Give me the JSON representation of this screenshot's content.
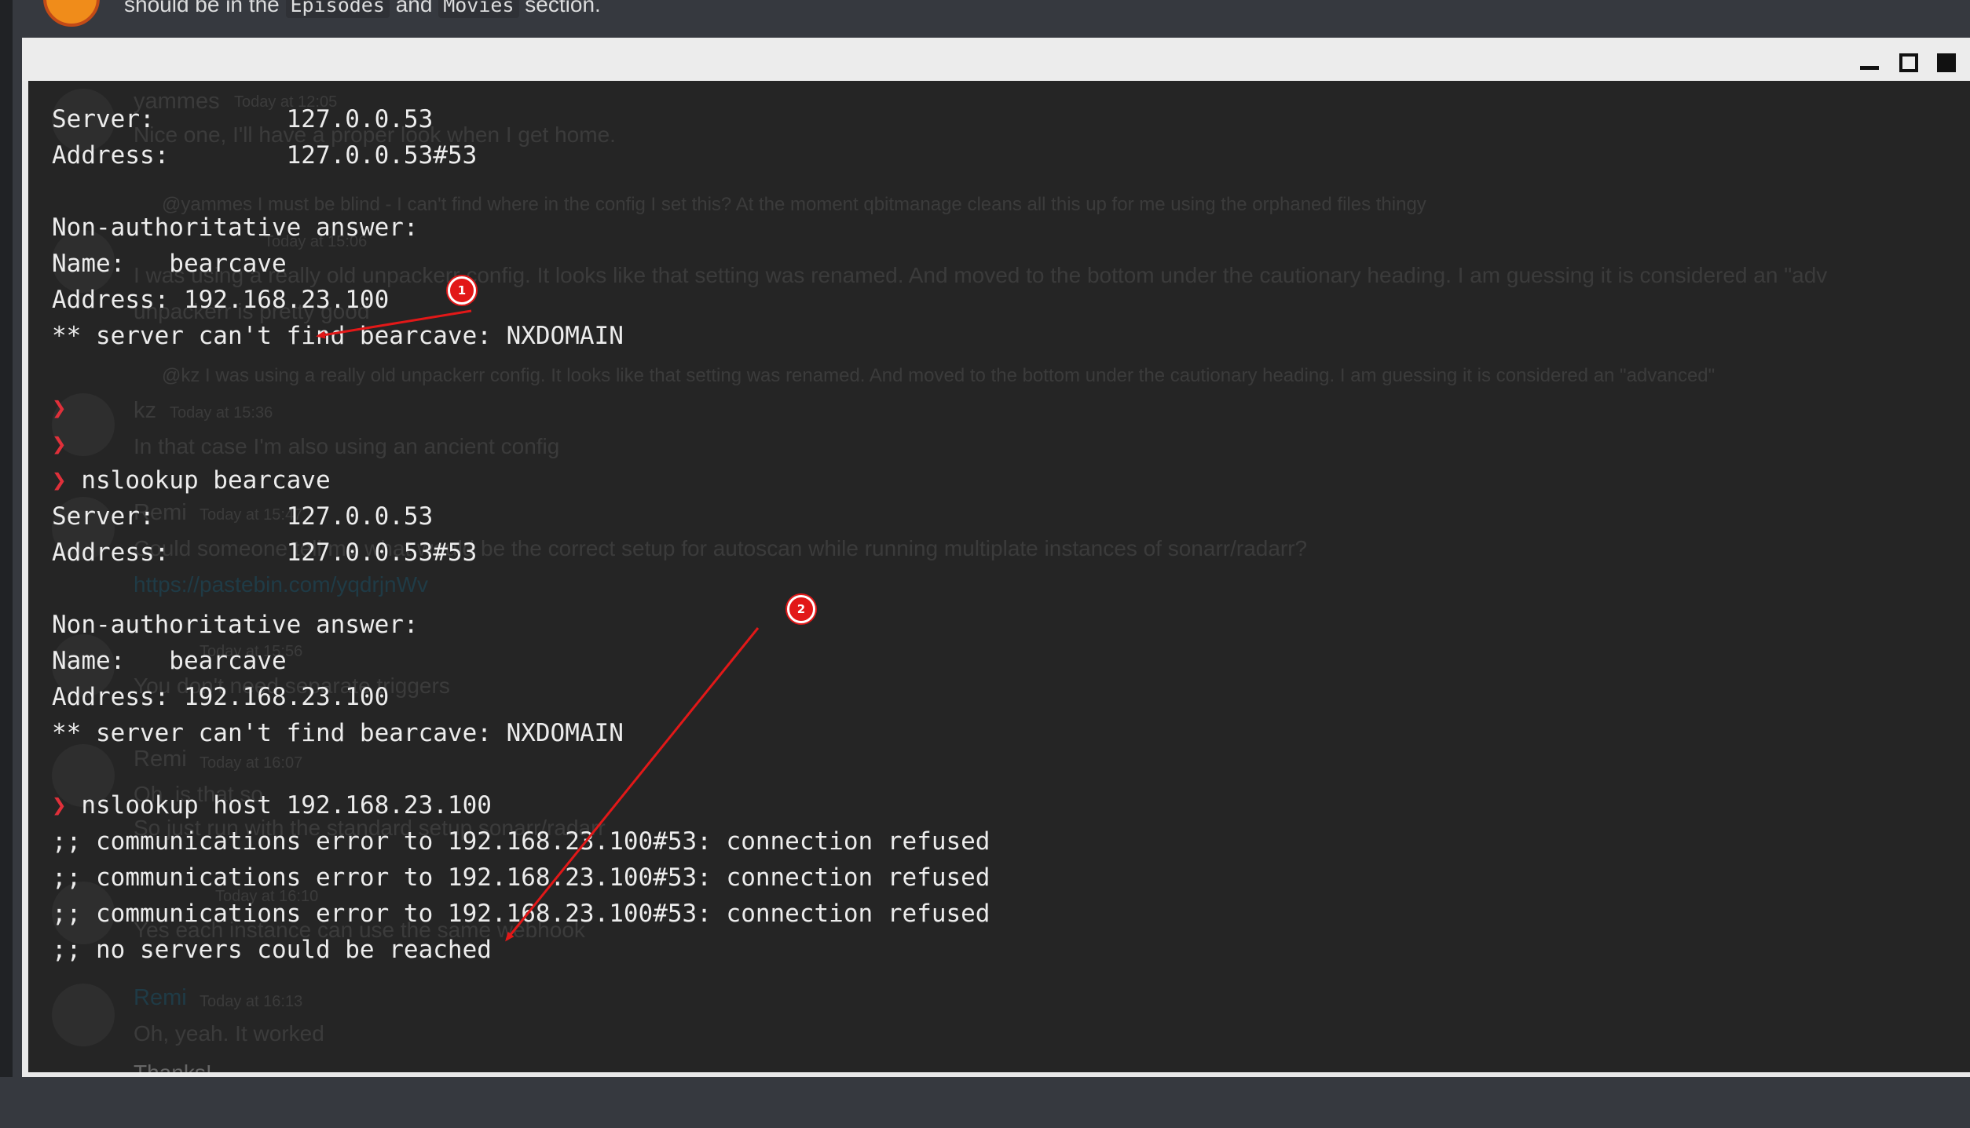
{
  "background_message": {
    "text_before": "should be in the ",
    "code1": "Episodes",
    "text_mid": " and ",
    "code2": "Movies",
    "text_after": " section."
  },
  "ghost_chat": {
    "m1_name": "yammes",
    "m1_time": "Today at 12:05",
    "m1_text": "Nice one, I'll have a proper look when I get home.",
    "m2_reply": "@yammes I must be blind - I can't find where in the config I set this? At the moment qbitmanage cleans all this up for me using the orphaned files thingy",
    "m3_time": "Today at 15:06",
    "m3_text": "I was using a really old unpackerr config. It looks like that setting was renamed. And moved to the bottom under the cautionary heading. I am guessing it is considered an \"adv",
    "m3_text2": "unpackerr is pretty good",
    "m4_reply": "@kz I was using a really old unpackerr config. It looks like that setting was renamed. And moved to the bottom under the cautionary heading. I am guessing it is considered an \"advanced\"",
    "m5_name": "kz",
    "m5_time": "Today at 15:36",
    "m5_text": "In that case I'm also using an ancient config",
    "m6_name": "Remi",
    "m6_time": "Today at 15:47",
    "m6_text": "Could someone tell me what would be the correct setup for autoscan while running multiplate instances of sonarr/radarr?",
    "m6_link": "https://pastebin.com/yqdrjnWv",
    "m7_time": "Today at 15:56",
    "m7_text": "You don't need separate triggers",
    "m8_name": "Remi",
    "m8_time": "Today at 16:07",
    "m8_text": "Oh, is that so.",
    "m8_text2": "So just run with the standard setup sonarr/radarr",
    "m9_time": "Today at 16:10",
    "m9_text": "Yes each instance can use the same webhook",
    "m10_name": "Remi",
    "m10_time": "Today at 16:13",
    "m10_text": "Oh, yeah. It worked",
    "m10_text2": "Thanks!"
  },
  "terminal": {
    "lines": [
      {
        "prompt": "",
        "text": "Server:         127.0.0.53"
      },
      {
        "prompt": "",
        "text": "Address:        127.0.0.53#53"
      },
      {
        "prompt": "",
        "text": ""
      },
      {
        "prompt": "",
        "text": "Non-authoritative answer:"
      },
      {
        "prompt": "",
        "text": "Name:   bearcave"
      },
      {
        "prompt": "",
        "text": "Address: 192.168.23.100"
      },
      {
        "prompt": "",
        "text": "** server can't find bearcave: NXDOMAIN"
      },
      {
        "prompt": "",
        "text": ""
      },
      {
        "prompt": "❯",
        "text": ""
      },
      {
        "prompt": "❯",
        "text": ""
      },
      {
        "prompt": "❯",
        "text": " nslookup bearcave"
      },
      {
        "prompt": "",
        "text": "Server:         127.0.0.53"
      },
      {
        "prompt": "",
        "text": "Address:        127.0.0.53#53"
      },
      {
        "prompt": "",
        "text": ""
      },
      {
        "prompt": "",
        "text": "Non-authoritative answer:"
      },
      {
        "prompt": "",
        "text": "Name:   bearcave"
      },
      {
        "prompt": "",
        "text": "Address: 192.168.23.100"
      },
      {
        "prompt": "",
        "text": "** server can't find bearcave: NXDOMAIN"
      },
      {
        "prompt": "",
        "text": ""
      },
      {
        "prompt": "❯",
        "text": " nslookup host 192.168.23.100"
      },
      {
        "prompt": "",
        "text": ";; communications error to 192.168.23.100#53: connection refused"
      },
      {
        "prompt": "",
        "text": ";; communications error to 192.168.23.100#53: connection refused"
      },
      {
        "prompt": "",
        "text": ";; communications error to 192.168.23.100#53: connection refused"
      },
      {
        "prompt": "",
        "text": ";; no servers could be reached"
      }
    ]
  },
  "annotations": {
    "badge1": "1",
    "badge2": "2"
  },
  "colors": {
    "terminal_bg": "#252525",
    "prompt": "#e0303a",
    "annotation": "#e21818"
  }
}
